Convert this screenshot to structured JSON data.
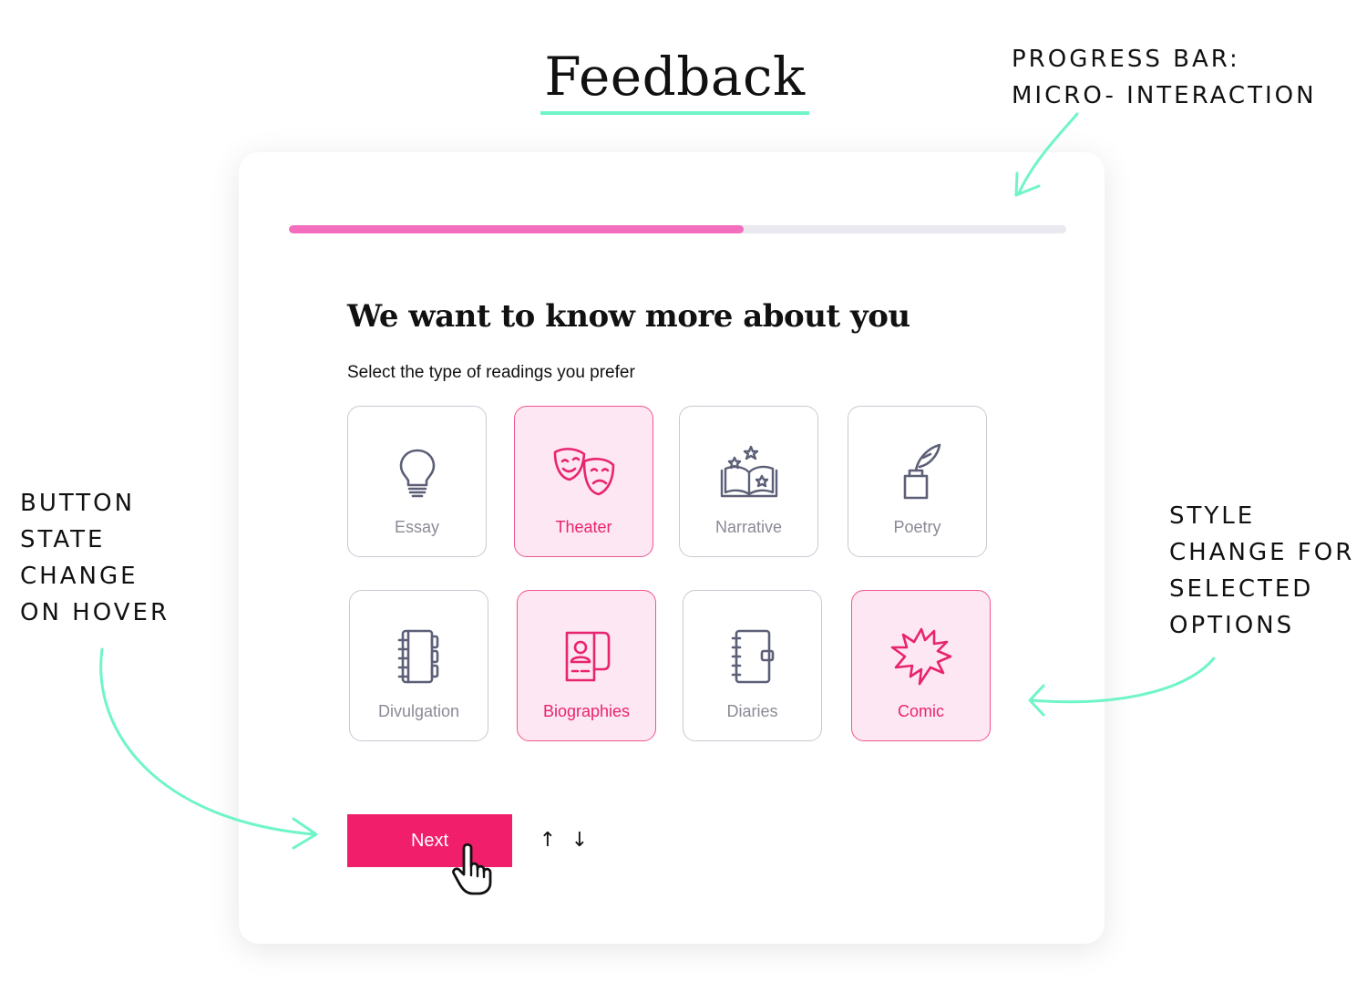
{
  "title": "Feedback",
  "annotations": {
    "progress_bar": [
      "PROGRESS BAR:",
      "MICRO- INTERACTION"
    ],
    "button_state": [
      "BUTTON",
      "STATE",
      "CHANGE",
      "ON HOVER"
    ],
    "style_change": [
      "STYLE",
      "CHANGE FOR",
      "SELECTED",
      "OPTIONS"
    ]
  },
  "progress": {
    "value": 0.585
  },
  "form": {
    "heading": "We want to know more about you",
    "subheading": "Select the type of readings you prefer",
    "options": [
      {
        "label": "Essay",
        "icon": "lightbulb-icon",
        "selected": false
      },
      {
        "label": "Theater",
        "icon": "theater-masks-icon",
        "selected": true
      },
      {
        "label": "Narrative",
        "icon": "open-book-stars-icon",
        "selected": false
      },
      {
        "label": "Poetry",
        "icon": "quill-inkwell-icon",
        "selected": false
      },
      {
        "label": "Divulgation",
        "icon": "notebook-icon",
        "selected": false
      },
      {
        "label": "Biographies",
        "icon": "contact-book-icon",
        "selected": true
      },
      {
        "label": "Diaries",
        "icon": "diary-icon",
        "selected": false
      },
      {
        "label": "Comic",
        "icon": "speech-burst-icon",
        "selected": true
      }
    ],
    "next_label": "Next",
    "up_arrow": "↑",
    "down_arrow": "↓"
  },
  "colors": {
    "accent_pink": "#f11e6b",
    "progress_pink": "#f36fbe",
    "selected_bg": "#fde7f2",
    "annotation_mint": "#6ff5c6"
  }
}
